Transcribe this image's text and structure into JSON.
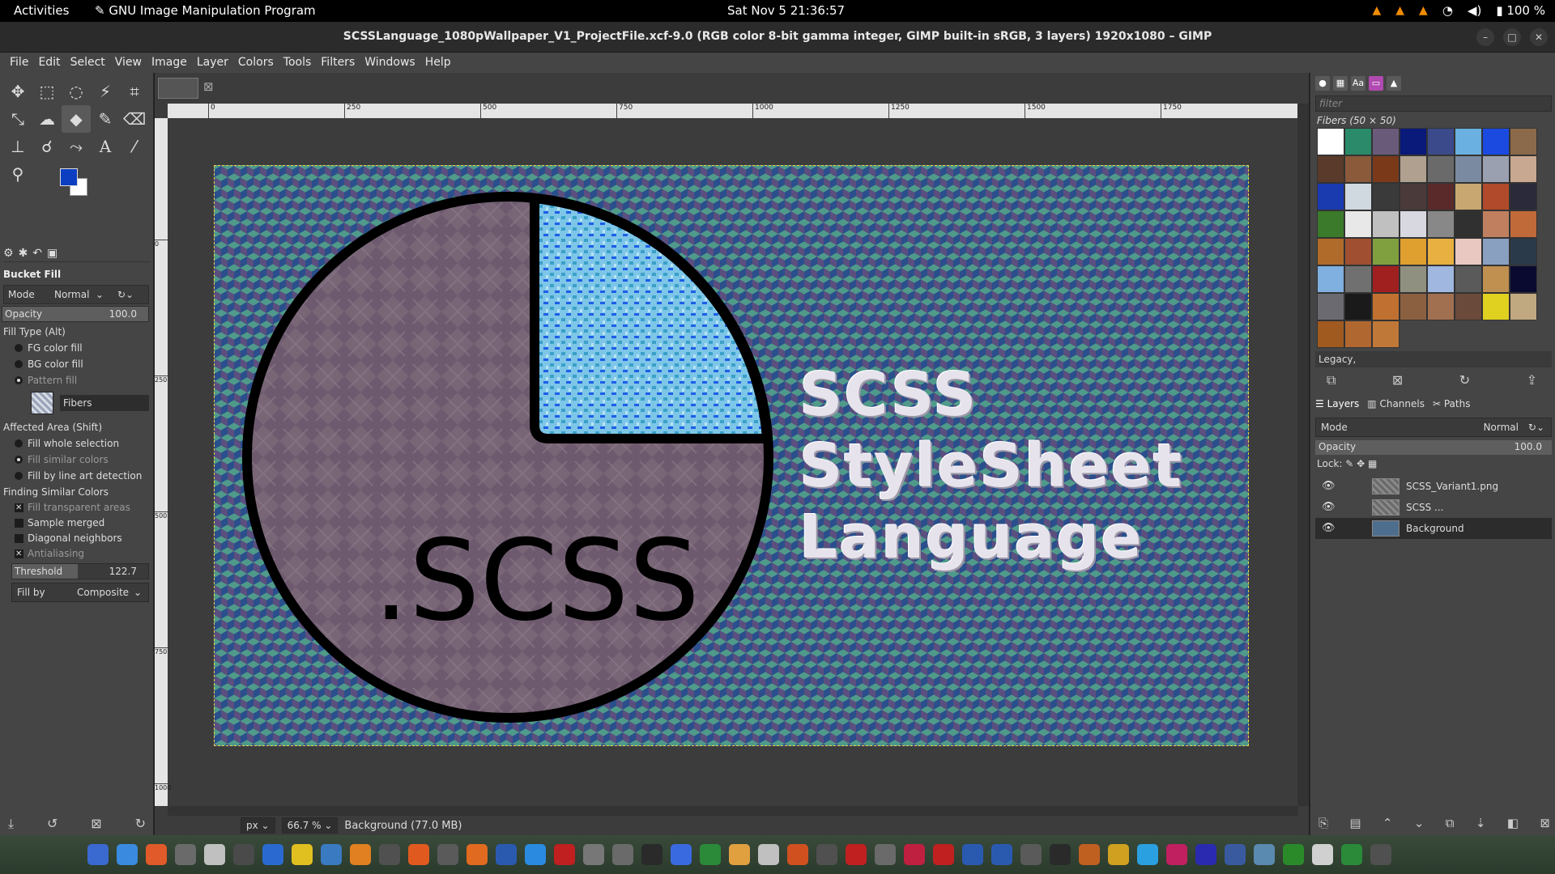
{
  "topbar": {
    "activities": "Activities",
    "app_name": "GNU Image Manipulation Program",
    "clock": "Sat Nov 5  21:36:57",
    "battery": "100 %"
  },
  "window": {
    "title": "SCSSLanguage_1080pWallpaper_V1_ProjectFile.xcf-9.0 (RGB color 8-bit gamma integer, GIMP built-in sRGB, 3 layers) 1920x1080 – GIMP"
  },
  "menu": [
    "File",
    "Edit",
    "Select",
    "View",
    "Image",
    "Layer",
    "Colors",
    "Tools",
    "Filters",
    "Windows",
    "Help"
  ],
  "toolbox": {
    "fg_color": "#0b3ec0",
    "bg_color": "#ffffff",
    "options_title": "Bucket Fill",
    "mode_label": "Mode",
    "mode_value": "Normal",
    "opacity_label": "Opacity",
    "opacity_value": "100.0",
    "opacity_fraction": 1.0,
    "fill_type_label": "Fill Type  (Alt)",
    "fill_types": [
      "FG color fill",
      "BG color fill",
      "Pattern fill"
    ],
    "pattern_name": "Fibers",
    "affected_area_label": "Affected Area  (Shift)",
    "affected_areas": [
      "Fill whole selection",
      "Fill similar colors",
      "Fill by line art detection"
    ],
    "finding_label": "Finding Similar Colors",
    "checks": [
      "Fill transparent areas",
      "Sample merged",
      "Diagonal neighbors",
      "Antialiasing"
    ],
    "threshold_label": "Threshold",
    "threshold_value": "122.7",
    "threshold_fraction": 0.48,
    "fill_by_label": "Fill by",
    "fill_by_value": "Composite"
  },
  "canvas": {
    "ruler_labels": [
      "0",
      "250",
      "500",
      "750",
      "1000",
      "1250",
      "1500",
      "1750"
    ],
    "vruler_labels": [
      "0",
      "250",
      "500",
      "750",
      "1000"
    ],
    "unit": "px",
    "zoom": "66.7 %",
    "status": "Background (77.0 MB)",
    "image_text_circle": ".SCSS",
    "image_text_lines": [
      "SCSS",
      "StyleSheet",
      "Language"
    ]
  },
  "right": {
    "filter_placeholder": "filter",
    "pattern_title": "Fibers (50 × 50)",
    "tag_select": "Legacy,",
    "tabs": [
      "Layers",
      "Channels",
      "Paths"
    ],
    "mode_label": "Mode",
    "mode_value": "Normal",
    "opacity_label": "Opacity",
    "opacity_value": "100.0",
    "lock_label": "Lock:",
    "layers": [
      {
        "name": "SCSS_Variant1.png"
      },
      {
        "name": "SCSS ..."
      },
      {
        "name": "Background"
      }
    ]
  }
}
